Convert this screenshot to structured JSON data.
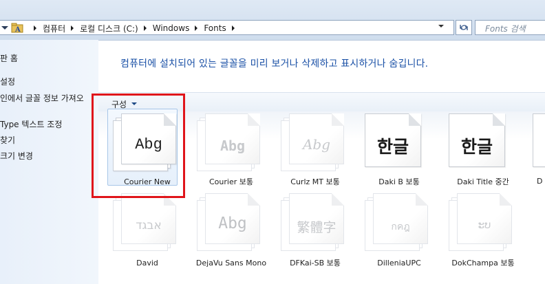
{
  "address_bar": {
    "crumbs": [
      "컴퓨터",
      "로컬 디스크 (C:)",
      "Windows",
      "Fonts"
    ],
    "search_placeholder": "Fonts 검색"
  },
  "sidebar": {
    "items": [
      {
        "label": "판 홈"
      },
      {
        "label": "설정"
      },
      {
        "label": "인에서 글꼴 정보 가져오"
      },
      {
        "label": "Type 텍스트 조정"
      },
      {
        "label": "찾기"
      },
      {
        "label": "크기 변경"
      }
    ]
  },
  "main": {
    "description": "컴퓨터에 설치되어 있는 글꼴을 미리 보거나 삭제하고 표시하거나 숨깁니다.",
    "organize_label": "구성"
  },
  "fonts": [
    {
      "name": "Courier New",
      "sample": "Abg",
      "selected": true
    },
    {
      "name": "Courier 보통",
      "sample": "Abg"
    },
    {
      "name": "Curlz MT 보통",
      "sample": "Abg"
    },
    {
      "name": "Daki B 보통",
      "sample": "한글"
    },
    {
      "name": "Daki Title 중간",
      "sample": "한글"
    },
    {
      "name": "D",
      "sample": ""
    },
    {
      "name": "David",
      "sample": "אבגד"
    },
    {
      "name": "DejaVu Sans Mono",
      "sample": "Abg"
    },
    {
      "name": "DFKai-SB 보통",
      "sample": "繁體字"
    },
    {
      "name": "DilleniaUPC",
      "sample": "กคฎ"
    },
    {
      "name": "DokChampa 보통",
      "sample": "ະບ"
    }
  ],
  "colors": {
    "description_text": "#1a50a6",
    "annotation_box": "#e0141a",
    "selection_border": "#a7c6e8"
  }
}
